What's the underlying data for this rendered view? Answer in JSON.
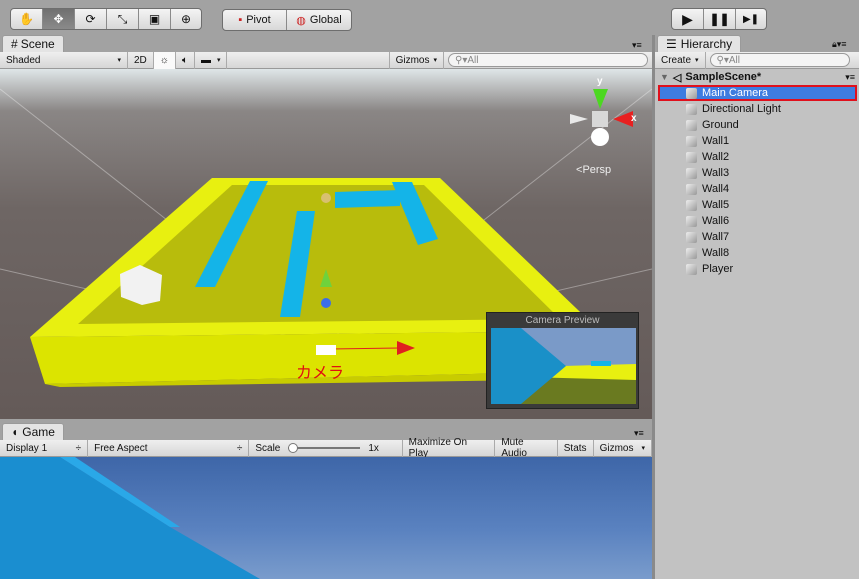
{
  "toolbar": {
    "tools": [
      "hand-tool",
      "move-tool",
      "rotate-tool",
      "scale-tool",
      "rect-tool",
      "transform-tool"
    ],
    "tool_glyphs": [
      "✋",
      "✥",
      "⟳",
      "⤡",
      "▣",
      "⊕"
    ],
    "pivot": "Pivot",
    "global": "Global",
    "play": "▶",
    "pause": "❚❚",
    "step": "▶❚"
  },
  "scene": {
    "tab": "Scene",
    "shading": "Shaded",
    "mode_2d": "2D",
    "gizmos": "Gizmos",
    "search_placeholder": "All",
    "persp": "Persp",
    "camera_label": "カメラ",
    "camera_preview_title": "Camera Preview",
    "axis_y": "y",
    "axis_x": "x"
  },
  "game": {
    "tab": "Game",
    "display": "Display 1",
    "aspect": "Free Aspect",
    "scale_label": "Scale",
    "scale_value": "1x",
    "maximize": "Maximize On Play",
    "mute": "Mute Audio",
    "stats": "Stats",
    "gizmos": "Gizmos"
  },
  "hierarchy": {
    "tab": "Hierarchy",
    "create": "Create",
    "search_placeholder": "All",
    "scene_name": "SampleScene*",
    "items": [
      "Main Camera",
      "Directional Light",
      "Ground",
      "Wall1",
      "Wall2",
      "Wall3",
      "Wall4",
      "Wall5",
      "Wall6",
      "Wall7",
      "Wall8",
      "Player"
    ],
    "selected": "Main Camera"
  },
  "colors": {
    "selection": "#3e7ce0",
    "highlight_border": "#e0101c",
    "platform": "#e8f010",
    "walls": "#14b4e8"
  }
}
